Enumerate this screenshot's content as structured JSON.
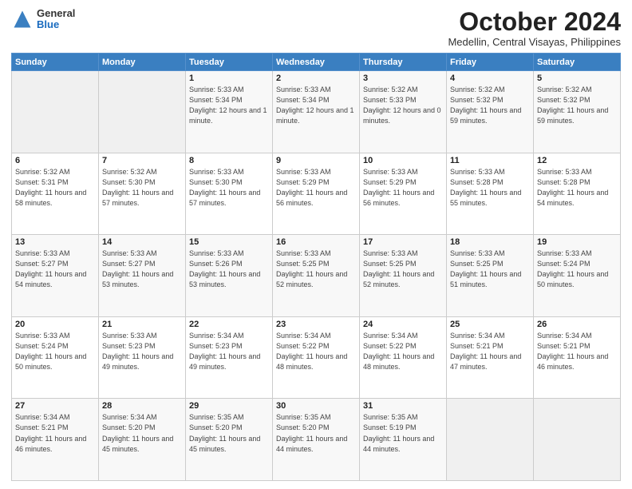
{
  "logo": {
    "general": "General",
    "blue": "Blue"
  },
  "title": "October 2024",
  "subtitle": "Medellin, Central Visayas, Philippines",
  "days_of_week": [
    "Sunday",
    "Monday",
    "Tuesday",
    "Wednesday",
    "Thursday",
    "Friday",
    "Saturday"
  ],
  "weeks": [
    [
      {
        "day": "",
        "sunrise": "",
        "sunset": "",
        "daylight": ""
      },
      {
        "day": "",
        "sunrise": "",
        "sunset": "",
        "daylight": ""
      },
      {
        "day": "1",
        "sunrise": "Sunrise: 5:33 AM",
        "sunset": "Sunset: 5:34 PM",
        "daylight": "Daylight: 12 hours and 1 minute."
      },
      {
        "day": "2",
        "sunrise": "Sunrise: 5:33 AM",
        "sunset": "Sunset: 5:34 PM",
        "daylight": "Daylight: 12 hours and 1 minute."
      },
      {
        "day": "3",
        "sunrise": "Sunrise: 5:32 AM",
        "sunset": "Sunset: 5:33 PM",
        "daylight": "Daylight: 12 hours and 0 minutes."
      },
      {
        "day": "4",
        "sunrise": "Sunrise: 5:32 AM",
        "sunset": "Sunset: 5:32 PM",
        "daylight": "Daylight: 11 hours and 59 minutes."
      },
      {
        "day": "5",
        "sunrise": "Sunrise: 5:32 AM",
        "sunset": "Sunset: 5:32 PM",
        "daylight": "Daylight: 11 hours and 59 minutes."
      }
    ],
    [
      {
        "day": "6",
        "sunrise": "Sunrise: 5:32 AM",
        "sunset": "Sunset: 5:31 PM",
        "daylight": "Daylight: 11 hours and 58 minutes."
      },
      {
        "day": "7",
        "sunrise": "Sunrise: 5:32 AM",
        "sunset": "Sunset: 5:30 PM",
        "daylight": "Daylight: 11 hours and 57 minutes."
      },
      {
        "day": "8",
        "sunrise": "Sunrise: 5:33 AM",
        "sunset": "Sunset: 5:30 PM",
        "daylight": "Daylight: 11 hours and 57 minutes."
      },
      {
        "day": "9",
        "sunrise": "Sunrise: 5:33 AM",
        "sunset": "Sunset: 5:29 PM",
        "daylight": "Daylight: 11 hours and 56 minutes."
      },
      {
        "day": "10",
        "sunrise": "Sunrise: 5:33 AM",
        "sunset": "Sunset: 5:29 PM",
        "daylight": "Daylight: 11 hours and 56 minutes."
      },
      {
        "day": "11",
        "sunrise": "Sunrise: 5:33 AM",
        "sunset": "Sunset: 5:28 PM",
        "daylight": "Daylight: 11 hours and 55 minutes."
      },
      {
        "day": "12",
        "sunrise": "Sunrise: 5:33 AM",
        "sunset": "Sunset: 5:28 PM",
        "daylight": "Daylight: 11 hours and 54 minutes."
      }
    ],
    [
      {
        "day": "13",
        "sunrise": "Sunrise: 5:33 AM",
        "sunset": "Sunset: 5:27 PM",
        "daylight": "Daylight: 11 hours and 54 minutes."
      },
      {
        "day": "14",
        "sunrise": "Sunrise: 5:33 AM",
        "sunset": "Sunset: 5:27 PM",
        "daylight": "Daylight: 11 hours and 53 minutes."
      },
      {
        "day": "15",
        "sunrise": "Sunrise: 5:33 AM",
        "sunset": "Sunset: 5:26 PM",
        "daylight": "Daylight: 11 hours and 53 minutes."
      },
      {
        "day": "16",
        "sunrise": "Sunrise: 5:33 AM",
        "sunset": "Sunset: 5:25 PM",
        "daylight": "Daylight: 11 hours and 52 minutes."
      },
      {
        "day": "17",
        "sunrise": "Sunrise: 5:33 AM",
        "sunset": "Sunset: 5:25 PM",
        "daylight": "Daylight: 11 hours and 52 minutes."
      },
      {
        "day": "18",
        "sunrise": "Sunrise: 5:33 AM",
        "sunset": "Sunset: 5:25 PM",
        "daylight": "Daylight: 11 hours and 51 minutes."
      },
      {
        "day": "19",
        "sunrise": "Sunrise: 5:33 AM",
        "sunset": "Sunset: 5:24 PM",
        "daylight": "Daylight: 11 hours and 50 minutes."
      }
    ],
    [
      {
        "day": "20",
        "sunrise": "Sunrise: 5:33 AM",
        "sunset": "Sunset: 5:24 PM",
        "daylight": "Daylight: 11 hours and 50 minutes."
      },
      {
        "day": "21",
        "sunrise": "Sunrise: 5:33 AM",
        "sunset": "Sunset: 5:23 PM",
        "daylight": "Daylight: 11 hours and 49 minutes."
      },
      {
        "day": "22",
        "sunrise": "Sunrise: 5:34 AM",
        "sunset": "Sunset: 5:23 PM",
        "daylight": "Daylight: 11 hours and 49 minutes."
      },
      {
        "day": "23",
        "sunrise": "Sunrise: 5:34 AM",
        "sunset": "Sunset: 5:22 PM",
        "daylight": "Daylight: 11 hours and 48 minutes."
      },
      {
        "day": "24",
        "sunrise": "Sunrise: 5:34 AM",
        "sunset": "Sunset: 5:22 PM",
        "daylight": "Daylight: 11 hours and 48 minutes."
      },
      {
        "day": "25",
        "sunrise": "Sunrise: 5:34 AM",
        "sunset": "Sunset: 5:21 PM",
        "daylight": "Daylight: 11 hours and 47 minutes."
      },
      {
        "day": "26",
        "sunrise": "Sunrise: 5:34 AM",
        "sunset": "Sunset: 5:21 PM",
        "daylight": "Daylight: 11 hours and 46 minutes."
      }
    ],
    [
      {
        "day": "27",
        "sunrise": "Sunrise: 5:34 AM",
        "sunset": "Sunset: 5:21 PM",
        "daylight": "Daylight: 11 hours and 46 minutes."
      },
      {
        "day": "28",
        "sunrise": "Sunrise: 5:34 AM",
        "sunset": "Sunset: 5:20 PM",
        "daylight": "Daylight: 11 hours and 45 minutes."
      },
      {
        "day": "29",
        "sunrise": "Sunrise: 5:35 AM",
        "sunset": "Sunset: 5:20 PM",
        "daylight": "Daylight: 11 hours and 45 minutes."
      },
      {
        "day": "30",
        "sunrise": "Sunrise: 5:35 AM",
        "sunset": "Sunset: 5:20 PM",
        "daylight": "Daylight: 11 hours and 44 minutes."
      },
      {
        "day": "31",
        "sunrise": "Sunrise: 5:35 AM",
        "sunset": "Sunset: 5:19 PM",
        "daylight": "Daylight: 11 hours and 44 minutes."
      },
      {
        "day": "",
        "sunrise": "",
        "sunset": "",
        "daylight": ""
      },
      {
        "day": "",
        "sunrise": "",
        "sunset": "",
        "daylight": ""
      }
    ]
  ]
}
